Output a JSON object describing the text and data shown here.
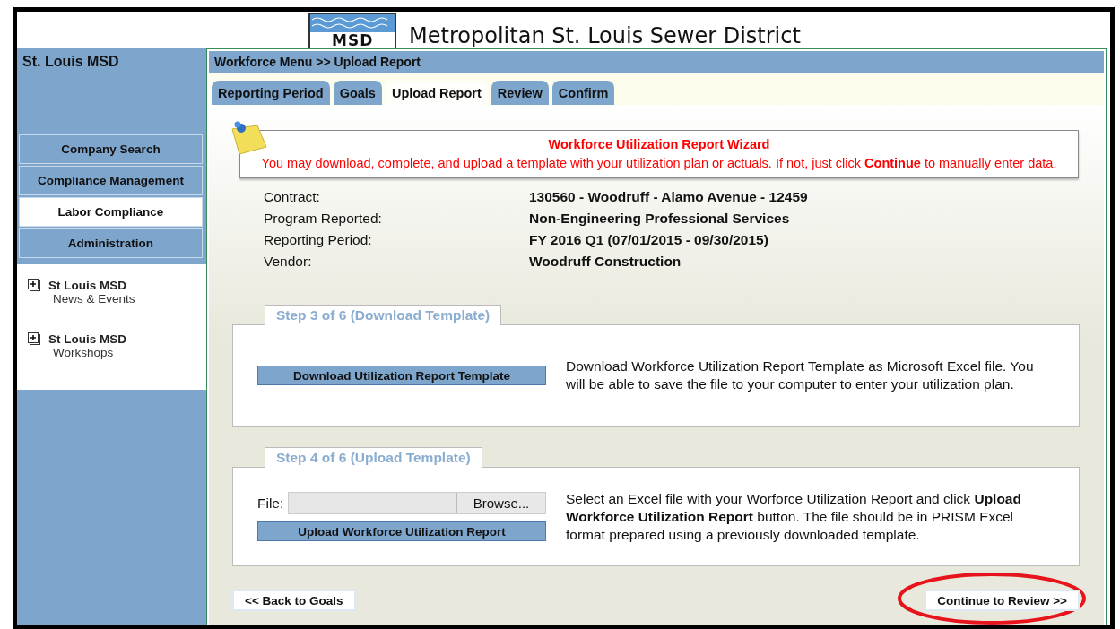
{
  "header": {
    "logo_text": "MSD",
    "title": "Metropolitan St. Louis Sewer District"
  },
  "sidebar": {
    "title": "St. Louis MSD",
    "menu": [
      {
        "label": "Company Search",
        "selected": false
      },
      {
        "label": "Compliance Management",
        "selected": false
      },
      {
        "label": "Labor Compliance",
        "selected": true
      },
      {
        "label": "Administration",
        "selected": false
      }
    ],
    "links": [
      {
        "title": "St Louis MSD",
        "subtitle": "News & Events"
      },
      {
        "title": "St Louis MSD",
        "subtitle": "Workshops"
      }
    ]
  },
  "breadcrumb": "Workforce Menu >> Upload Report",
  "tabs": [
    {
      "label": "Reporting Period",
      "selected": false
    },
    {
      "label": "Goals",
      "selected": false
    },
    {
      "label": "Upload Report",
      "selected": true
    },
    {
      "label": "Review",
      "selected": false
    },
    {
      "label": "Confirm",
      "selected": false
    }
  ],
  "notice": {
    "title": "Workforce Utilization Report Wizard",
    "text": "You may download, complete, and upload a template with your utilization plan or actuals. If not, just click **Continue** to manually enter data."
  },
  "details": [
    {
      "label": "Contract:",
      "value": "130560 - Woodruff - Alamo Avenue - 12459"
    },
    {
      "label": "Program Reported:",
      "value": "Non-Engineering Professional Services"
    },
    {
      "label": "Reporting Period:",
      "value": "FY 2016 Q1 (07/01/2015 - 09/30/2015)"
    },
    {
      "label": "Vendor:",
      "value": "Woodruff Construction"
    }
  ],
  "steps": [
    {
      "kind": "download",
      "legend": "Step 3 of 6 (Download Template)",
      "button": "Download Utilization Report Template",
      "description": "Download Workforce Utilization Report Template as Microsoft Excel file. You will be able to save the file to your computer to enter your utilization plan."
    },
    {
      "kind": "upload",
      "legend": "Step 4 of 6 (Upload Template)",
      "file_label": "File:",
      "browse": "Browse...",
      "button": "Upload Workforce Utilization Report",
      "description": "Select an Excel file with your Worforce Utilization Report and click **Upload Workforce Utilization Report** button. The file should be in PRISM Excel format prepared using a previously downloaded template."
    }
  ],
  "footer": {
    "back": {
      "label": "<< Back to Goals",
      "circled": false
    },
    "continue": {
      "label": "Continue to Review >>",
      "circled": true
    }
  }
}
